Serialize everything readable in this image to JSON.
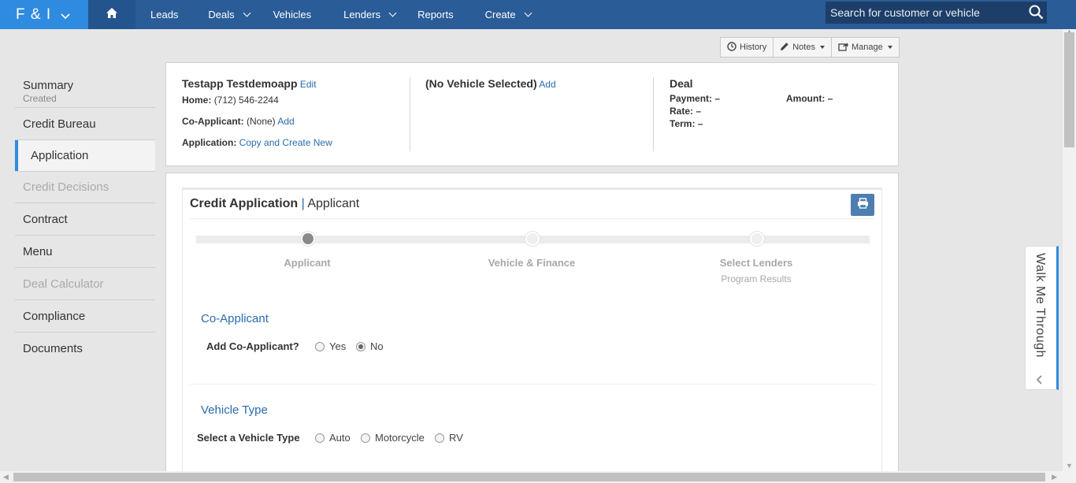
{
  "brand": {
    "name": "F & I"
  },
  "nav": {
    "items": [
      {
        "label": "Leads",
        "caret": false
      },
      {
        "label": "Deals",
        "caret": true
      },
      {
        "label": "Vehicles",
        "caret": false
      },
      {
        "label": "Lenders",
        "caret": true
      },
      {
        "label": "Reports",
        "caret": false
      },
      {
        "label": "Create",
        "caret": true
      }
    ],
    "search_placeholder": "Search for customer or vehicle"
  },
  "toolbar": {
    "history_label": "History",
    "notes_label": "Notes",
    "manage_label": "Manage"
  },
  "sidebar": {
    "summary_label": "Summary",
    "summary_status": "Created",
    "items": [
      {
        "label": "Credit Bureau"
      },
      {
        "label": "Application"
      },
      {
        "label": "Credit Decisions"
      },
      {
        "label": "Contract"
      },
      {
        "label": "Menu"
      },
      {
        "label": "Deal Calculator"
      },
      {
        "label": "Compliance"
      },
      {
        "label": "Documents"
      }
    ]
  },
  "customer": {
    "name": "Testapp Testdemoapp",
    "edit_link": "Edit",
    "home_label": "Home:",
    "home_phone": "(712) 546-2244",
    "coapp_label": "Co-Applicant:",
    "coapp_value": "(None)",
    "coapp_add": "Add",
    "application_label": "Application:",
    "application_link": "Copy and Create New"
  },
  "vehicle": {
    "title": "(No Vehicle Selected)",
    "add_link": "Add"
  },
  "deal": {
    "title": "Deal",
    "payment_label": "Payment:",
    "payment_value": "–",
    "amount_label": "Amount:",
    "amount_value": "–",
    "rate_label": "Rate:",
    "rate_value": "–",
    "term_label": "Term:",
    "term_value": "–"
  },
  "credit_app": {
    "title": "Credit Application",
    "separator": "|",
    "subtitle": "Applicant",
    "steps": [
      {
        "label": "Applicant",
        "sub": ""
      },
      {
        "label": "Vehicle & Finance",
        "sub": ""
      },
      {
        "label": "Select Lenders",
        "sub": "Program Results"
      }
    ],
    "coapp_section": "Co-Applicant",
    "coapp_question": "Add Co-Applicant?",
    "coapp_options": [
      "Yes",
      "No"
    ],
    "coapp_selected": "No",
    "vehicle_section": "Vehicle Type",
    "vehicle_question": "Select a Vehicle Type",
    "vehicle_options": [
      "Auto",
      "Motorcycle",
      "RV"
    ]
  },
  "walkme": {
    "label": "Walk Me Through"
  },
  "colors": {
    "nav_bg": "#2a5c98",
    "brand_bg": "#2e8be0",
    "link": "#2a6bb0",
    "accent": "#2e8be0"
  }
}
